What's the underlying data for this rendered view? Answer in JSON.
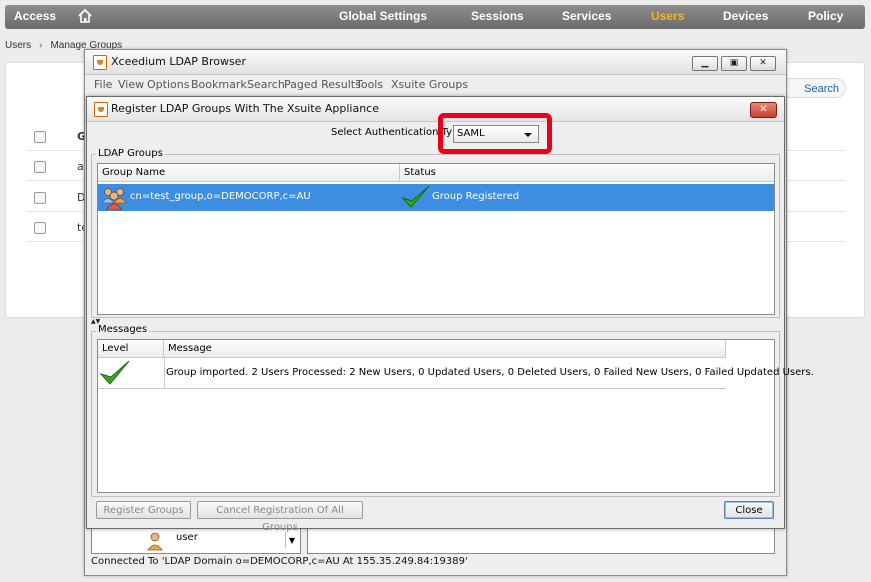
{
  "nav": {
    "brand": "Access",
    "items": [
      "Global Settings",
      "Sessions",
      "Services",
      "Users",
      "Devices",
      "Policy"
    ],
    "active": "Users"
  },
  "breadcrumb": {
    "items": [
      "Users",
      "Manage Groups"
    ]
  },
  "web": {
    "search_label": "Search",
    "header_partial": "G",
    "rows_partial": [
      "al",
      "D",
      "te"
    ]
  },
  "browser": {
    "title": "Xceedium LDAP Browser",
    "menu": [
      "File",
      "View",
      "Options",
      "Bookmark",
      "Search",
      "Paged Results",
      "Tools",
      "Xsuite Groups"
    ],
    "tree_item": "user",
    "status": "Connected To 'LDAP Domain o=DEMOCORP,c=AU At 155.35.249.84:19389'"
  },
  "dialog": {
    "title": "Register LDAP Groups With The Xsuite Appliance",
    "auth_label": "Select Authentication Type:",
    "auth_value": "SAML",
    "groups_section": "LDAP Groups",
    "groups_columns": [
      "Group Name",
      "Status"
    ],
    "groups_rows": [
      {
        "name": "cn=test_group,o=DEMOCORP,c=AU",
        "status": "Group Registered"
      }
    ],
    "messages_section": "Messages",
    "messages_columns": [
      "Level",
      "Message"
    ],
    "messages_rows": [
      {
        "message": "Group imported.  2 Users Processed:  2 New Users, 0 Updated Users, 0 Deleted Users, 0 Failed New Users, 0 Failed Updated Users."
      }
    ],
    "buttons": {
      "register": "Register Groups",
      "cancel": "Cancel Registration Of All Groups",
      "close": "Close"
    }
  },
  "colors": {
    "nav_active": "#f3b229",
    "selection": "#3d8ee0",
    "highlight": "#e8001c",
    "check": "#3aa61d"
  }
}
